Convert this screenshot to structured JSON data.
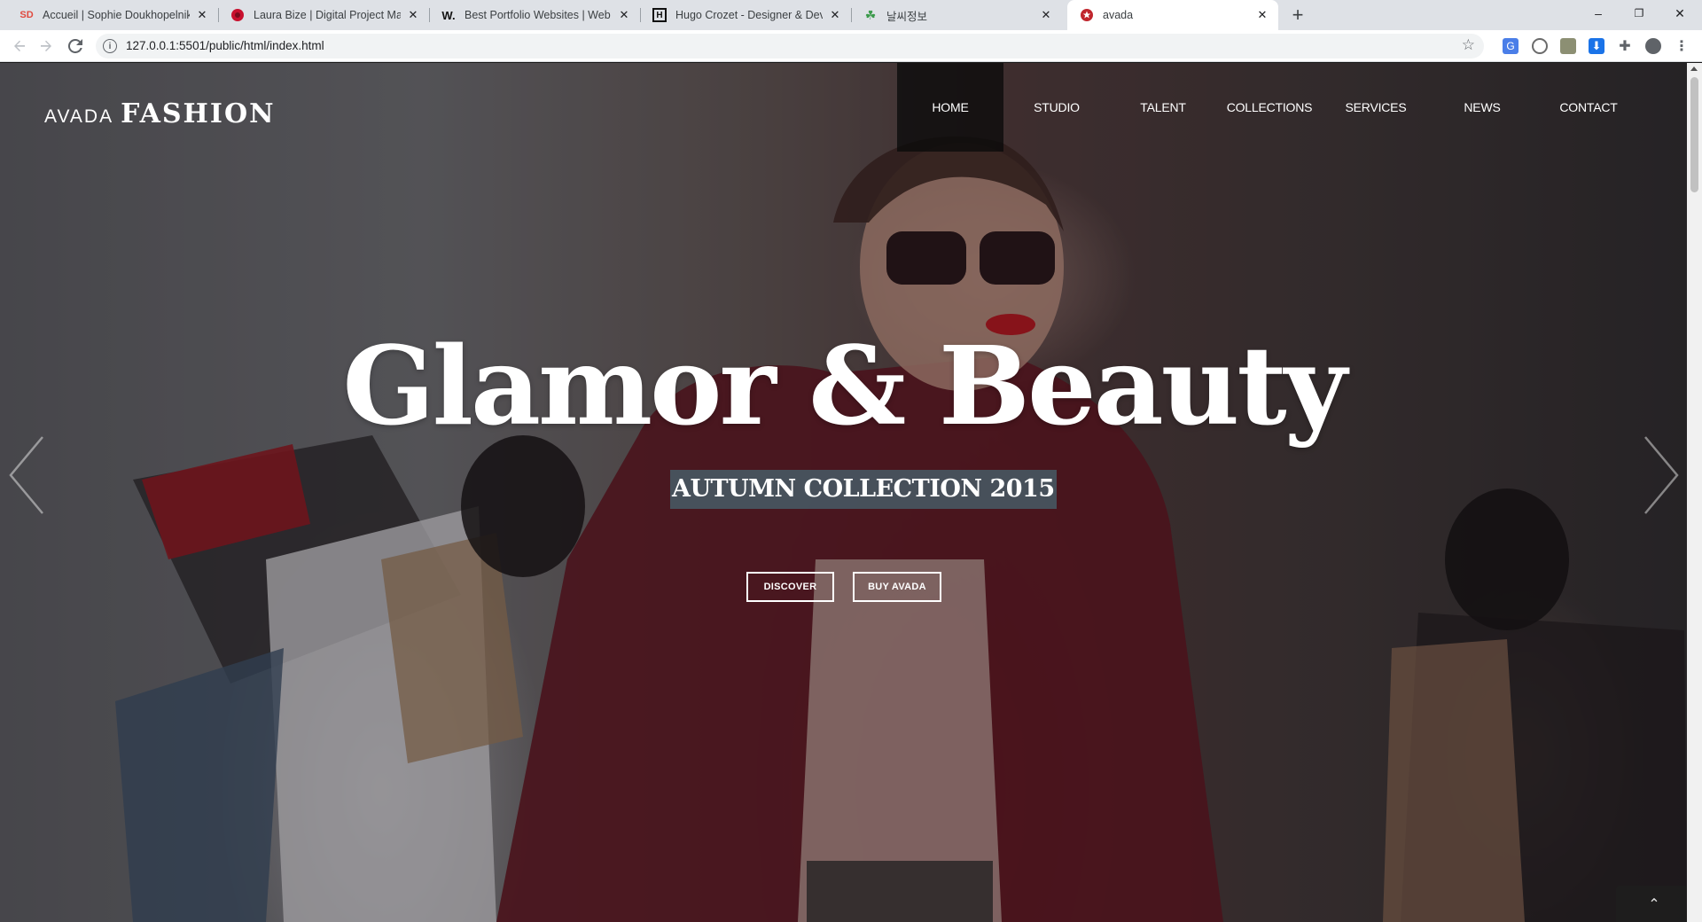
{
  "browser": {
    "tabs": [
      {
        "favicon_text": "SD",
        "favicon_color": "#e04a3f",
        "title": "Accueil | Sophie Doukhopelniko"
      },
      {
        "favicon_text": "",
        "favicon_color": "#c8102e",
        "title": "Laura Bize | Digital Project Man"
      },
      {
        "favicon_text": "W.",
        "favicon_color": "#111111",
        "title": "Best Portfolio Websites | Web D"
      },
      {
        "favicon_text": "H",
        "favicon_color": "#111111",
        "title": "Hugo Crozet - Designer & Deve"
      },
      {
        "favicon_text": "☘",
        "favicon_color": "#3a9a4a",
        "title": "날씨정보"
      },
      {
        "favicon_text": "★",
        "favicon_color": "#c0262d",
        "title": "avada"
      }
    ],
    "active_tab_index": 5,
    "new_tab_label": "+",
    "url": "127.0.0.1:5501/public/html/index.html",
    "window_controls": [
      "–",
      "❐",
      "✕"
    ]
  },
  "site": {
    "logo_light": "AVADA",
    "logo_bold": "FASHION",
    "nav": [
      "HOME",
      "STUDIO",
      "TALENT",
      "COLLECTIONS",
      "SERVICES",
      "NEWS",
      "CONTACT"
    ],
    "active_nav_index": 0,
    "headline": "Glamor & Beauty",
    "subheadline": "AUTUMN COLLECTION 2015",
    "buttons": {
      "discover": "DISCOVER",
      "buy": "BUY AVADA"
    },
    "back_to_top": "⌃"
  },
  "colors": {
    "active_nav_bg": "#0f0f0f",
    "subheadline_bg": "#46828c",
    "tab_strip": "#dee1e6"
  },
  "icons": [
    "info-icon",
    "star-icon",
    "translate-icon",
    "extension-icon",
    "profile-icon",
    "chevron-left-icon",
    "chevron-right-icon",
    "arrow-up-icon"
  ]
}
